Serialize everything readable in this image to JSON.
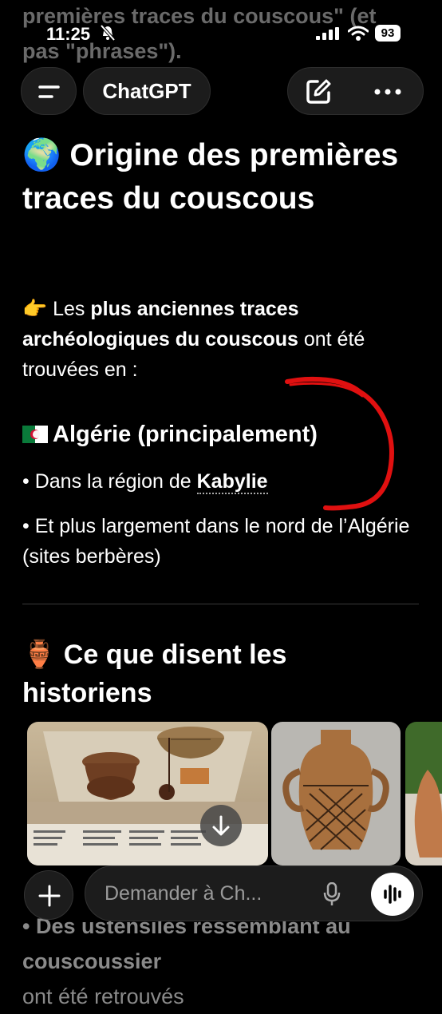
{
  "status_bar": {
    "time": "11:25",
    "battery": "93"
  },
  "background_text": {
    "line1": "premières traces du couscous\" (et",
    "line2": "pas \"phrases\")."
  },
  "header": {
    "title": "ChatGPT"
  },
  "section1": {
    "emoji": "🌍",
    "heading": "Origine des premières traces du couscous",
    "intro_emoji": "👉",
    "intro_pre": "Les",
    "intro_bold": "plus anciennes traces archéologiques du couscous",
    "intro_post": "ont été trouvées en :"
  },
  "algeria": {
    "title": "Algérie (principalement)",
    "bullet1_prefix": "Dans la région de",
    "bullet1_link": "Kabylie",
    "bullet2": "Et plus largement dans le nord de l’Algérie (sites berbères)"
  },
  "section2": {
    "emoji": "🏺",
    "heading": "Ce que disent les historiens"
  },
  "bottom_partial": {
    "line1": "• Des ustensiles ressemblant au",
    "line2_bold": "couscoussier",
    "line2_rest": "ont été retrouvés"
  },
  "composer": {
    "placeholder": "Demander à Ch..."
  },
  "colors": {
    "background": "#000000",
    "annotation": "#e01010"
  }
}
